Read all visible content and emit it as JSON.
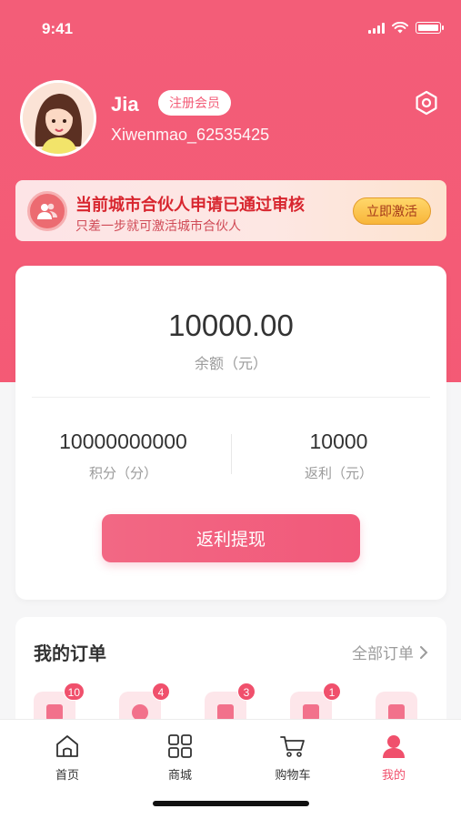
{
  "status_bar": {
    "time": "9:41"
  },
  "profile": {
    "name": "Jia",
    "badge": "注册会员",
    "user_id": "Xiwenmao_62535425"
  },
  "partner_banner": {
    "title": "当前城市合伙人申请已通过审核",
    "subtitle": "只差一步就可激活城市合伙人",
    "button": "立即激活"
  },
  "wallet": {
    "balance": "10000.00",
    "balance_label": "余额（元）",
    "points_value": "10000000000",
    "points_label": "积分（分）",
    "rebate_value": "10000",
    "rebate_label": "返利（元）",
    "withdraw_button": "返利提现"
  },
  "orders": {
    "title": "我的订单",
    "all_link": "全部订单",
    "items": [
      {
        "badge": "10"
      },
      {
        "badge": "4"
      },
      {
        "badge": "3"
      },
      {
        "badge": "1"
      },
      {
        "badge": ""
      }
    ]
  },
  "tabs": [
    {
      "label": "首页",
      "icon": "home-icon"
    },
    {
      "label": "商城",
      "icon": "grid-icon"
    },
    {
      "label": "购物车",
      "icon": "cart-icon"
    },
    {
      "label": "我的",
      "icon": "profile-icon",
      "active": true
    }
  ],
  "colors": {
    "primary": "#f35d78",
    "accent": "#f0506c",
    "banner_text": "#d8262f"
  }
}
